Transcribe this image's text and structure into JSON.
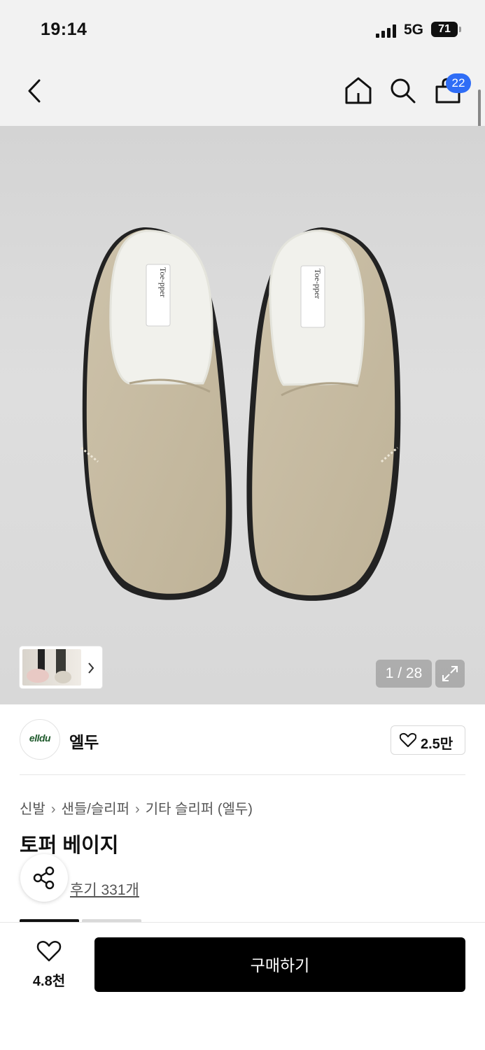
{
  "status_bar": {
    "time": "19:14",
    "network": "5G",
    "battery": "71"
  },
  "nav": {
    "cart_count": "22"
  },
  "gallery": {
    "pager": "1 / 28"
  },
  "brand": {
    "logo_text": "elldu",
    "name": "엘두",
    "likes": "2.5만"
  },
  "breadcrumb": {
    "items": [
      "신발",
      "샌들/슬리퍼",
      "기타 슬리퍼 (엘두)"
    ]
  },
  "product": {
    "title": "토퍼 베이지",
    "reviews": "후기 331개",
    "insole_label": "Toe-pper"
  },
  "bottom_bar": {
    "wish_count": "4.8천",
    "buy_label": "구매하기"
  },
  "colors": {
    "accent_badge": "#2f6df6",
    "buy_button": "#000000",
    "suede": "#c8bca4"
  }
}
